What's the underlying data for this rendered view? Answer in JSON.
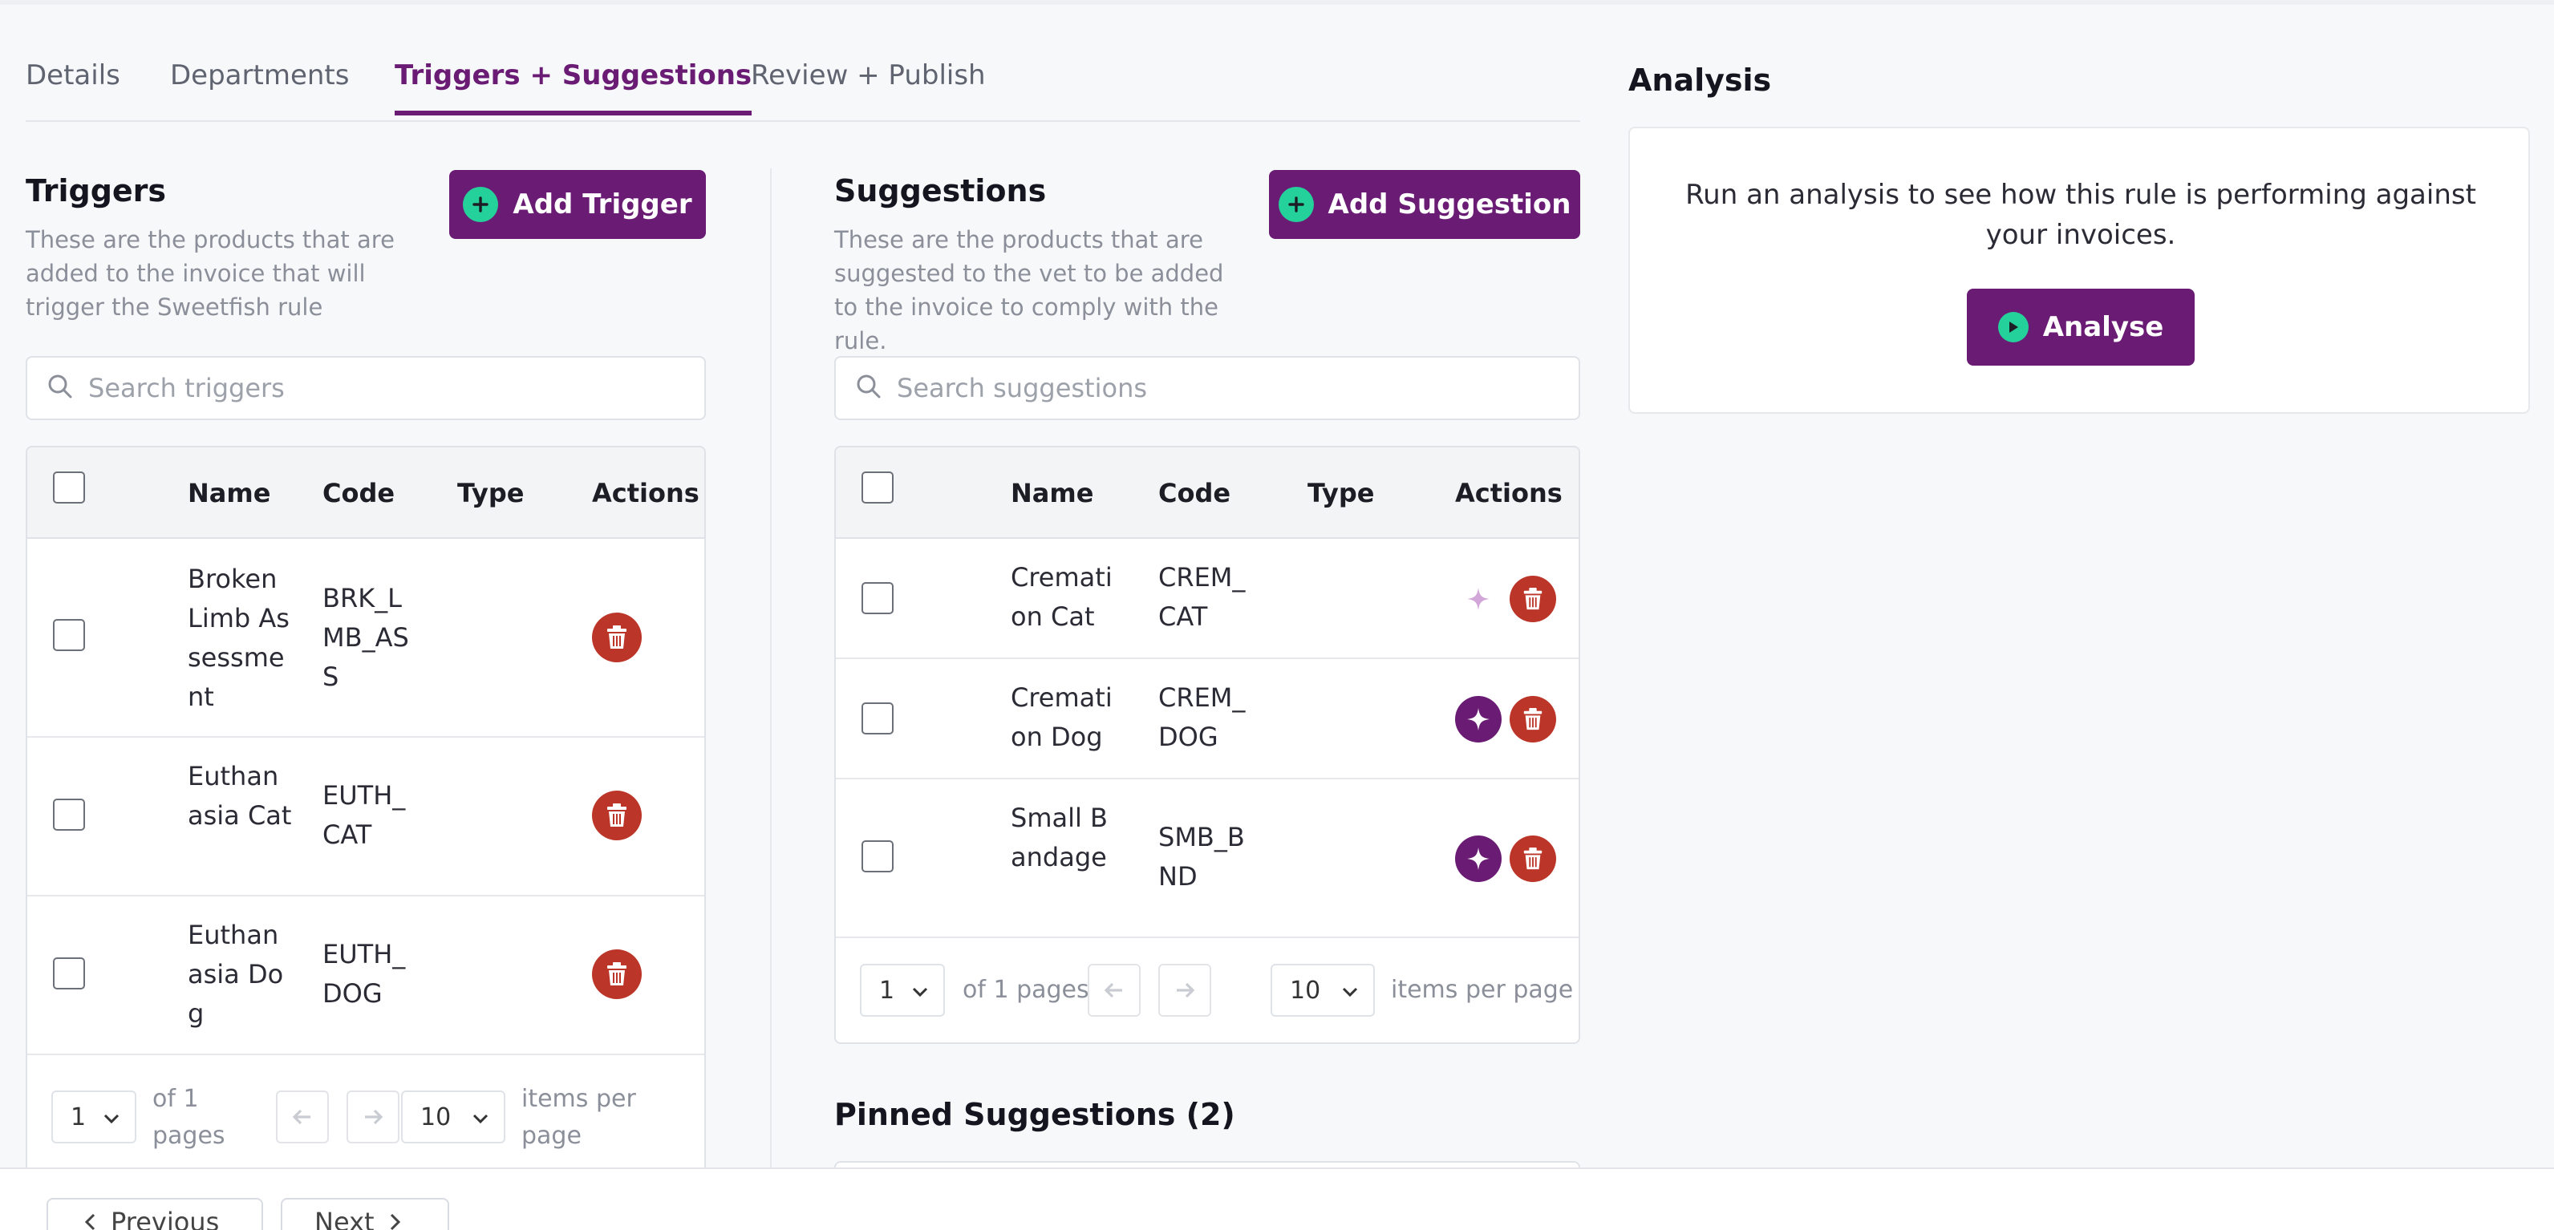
{
  "tabs": [
    {
      "label": "Details"
    },
    {
      "label": "Departments"
    },
    {
      "label": "Triggers + Suggestions"
    },
    {
      "label": "Review + Publish"
    }
  ],
  "triggers": {
    "title": "Triggers",
    "description": "These are the products that are added to the invoice that will trigger the Sweetfish rule",
    "add_label": "Add Trigger",
    "search_placeholder": "Search triggers",
    "columns": {
      "name": "Name",
      "code": "Code",
      "type": "Type",
      "actions": "Actions"
    },
    "rows": [
      {
        "name": "Broken Limb Assessment",
        "code": "BRK_LMB_ASS",
        "type": ""
      },
      {
        "name": "Euthanasia Cat",
        "code": "EUTH_CAT",
        "type": ""
      },
      {
        "name": "Euthanasia Dog",
        "code": "EUTH_DOG",
        "type": ""
      }
    ],
    "pager": {
      "page": "1",
      "of_pages": "of 1 pages",
      "per_page": "10",
      "per_page_label": "items per page"
    }
  },
  "suggestions": {
    "title": "Suggestions",
    "description": "These are the products that are suggested to the vet to be added to the invoice to comply with the rule.",
    "add_label": "Add Suggestion",
    "search_placeholder": "Search suggestions",
    "columns": {
      "name": "Name",
      "code": "Code",
      "type": "Type",
      "actions": "Actions"
    },
    "rows": [
      {
        "name": "Cremation Cat",
        "code": "CREM_CAT",
        "type": "",
        "pinned": false
      },
      {
        "name": "Cremation Dog",
        "code": "CREM_DOG",
        "type": "",
        "pinned": true
      },
      {
        "name": "Small Bandage",
        "code": "SMB_BND",
        "type": "",
        "pinned": true
      }
    ],
    "pager": {
      "page": "1",
      "of_pages": "of 1 pages",
      "per_page": "10",
      "per_page_label": "items per page"
    },
    "pinned_title": "Pinned Suggestions (2)"
  },
  "analysis": {
    "title": "Analysis",
    "text": "Run an analysis to see how this rule is performing against your invoices.",
    "button_label": "Analyse"
  },
  "footer": {
    "previous_label": "Previous",
    "next_label": "Next"
  },
  "colors": {
    "brand": "#6a1b74",
    "accent": "#24d19a",
    "danger": "#bb3528"
  },
  "icons": [
    "search-icon",
    "plus-icon",
    "trash-icon",
    "pin-icon",
    "play-icon",
    "chevron-down-icon",
    "arrow-left-icon",
    "arrow-right-icon"
  ]
}
